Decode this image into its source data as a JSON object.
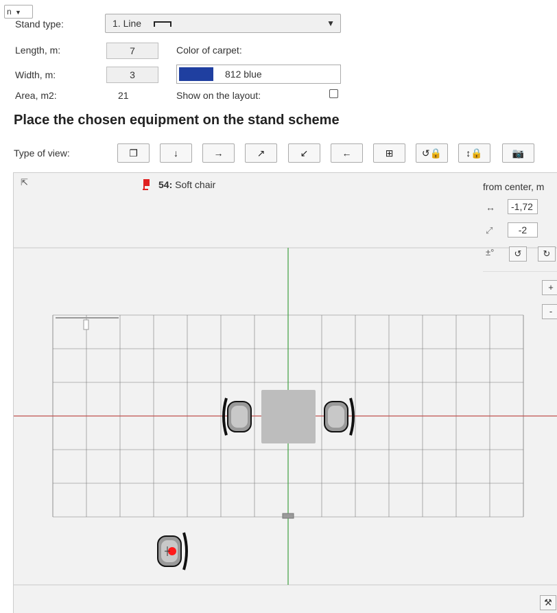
{
  "corner_select": {
    "value": "n"
  },
  "stand": {
    "type_label": "Stand type:",
    "type_value": "1. Line",
    "length_label": "Length, m:",
    "length_value": "7",
    "width_label": "Width, m:",
    "width_value": "3",
    "area_label": "Area, m2:",
    "area_value": "21",
    "carpet_label": "Color of carpet:",
    "carpet_value": "812 blue",
    "carpet_color": "#1f3fa0",
    "show_label": "Show on the layout:",
    "show_checked": false
  },
  "section_title": "Place the chosen equipment on the stand scheme",
  "view": {
    "label": "Type of view:",
    "buttons": [
      {
        "name": "view-3d-button",
        "glyph": "❐"
      },
      {
        "name": "view-down-button",
        "glyph": "↓"
      },
      {
        "name": "view-right-button",
        "glyph": "→"
      },
      {
        "name": "view-up-right-button",
        "glyph": "↗"
      },
      {
        "name": "view-down-left-button",
        "glyph": "↙"
      },
      {
        "name": "view-left-button",
        "glyph": "←"
      },
      {
        "name": "view-grid-button",
        "glyph": "⊞"
      },
      {
        "name": "rotate-lock-button",
        "glyph": "↺🔒"
      },
      {
        "name": "height-lock-button",
        "glyph": "↕🔒"
      },
      {
        "name": "camera-button",
        "glyph": "📷"
      }
    ]
  },
  "scheme": {
    "collapse_icon": "⇱",
    "selected_item_number": "54:",
    "selected_item_name": "Soft chair",
    "from_center_label": "from center, m",
    "horizontal_symbol": "↔",
    "horizontal_value": "-1,72",
    "diagonal_symbol": "⤢",
    "diagonal_value": "-2",
    "rotation_symbol": "±°",
    "rotate_ccw": "↺",
    "rotate_cw": "↻",
    "zoom_in": "+",
    "zoom_out": "-",
    "tools_icon": "⚒",
    "grid_line_color": "#777777",
    "axis_x_color": "#c0504d",
    "axis_y_color": "#3fa040",
    "table_color": "#bdbdbd"
  }
}
